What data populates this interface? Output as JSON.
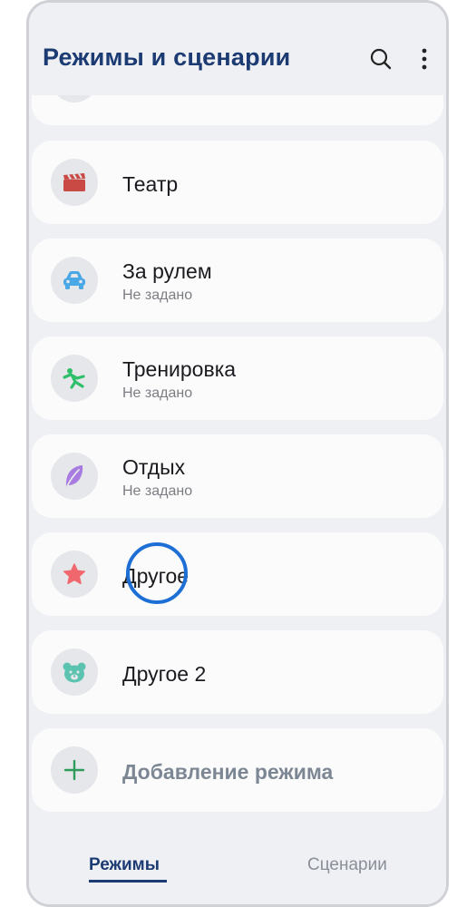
{
  "header": {
    "title": "Режимы и сценарии"
  },
  "modes": [
    {
      "title": "Театр",
      "subtitle": "",
      "icon": "theater-clapperboard-icon"
    },
    {
      "title": "За рулем",
      "subtitle": "Не задано",
      "icon": "car-icon"
    },
    {
      "title": "Тренировка",
      "subtitle": "Не задано",
      "icon": "running-person-icon"
    },
    {
      "title": "Отдых",
      "subtitle": "Не задано",
      "icon": "leaf-icon"
    },
    {
      "title": "Другое",
      "subtitle": "",
      "icon": "star-icon"
    },
    {
      "title": "Другое 2",
      "subtitle": "",
      "icon": "bear-face-icon"
    }
  ],
  "add_mode": {
    "label": "Добавление режима",
    "icon": "plus-icon"
  },
  "bottom_nav": {
    "tabs": [
      {
        "label": "Режимы",
        "active": true
      },
      {
        "label": "Сценарии",
        "active": false
      }
    ]
  },
  "colors": {
    "accent": "#1c3b73",
    "theater": "#c94a45",
    "car": "#4aa8e6",
    "workout": "#2fbf6a",
    "rest": "#a77be0",
    "star": "#f0686d",
    "bear": "#5cc3b0",
    "plus": "#2e9b5a",
    "tap_indicator": "#1d6fd6"
  }
}
